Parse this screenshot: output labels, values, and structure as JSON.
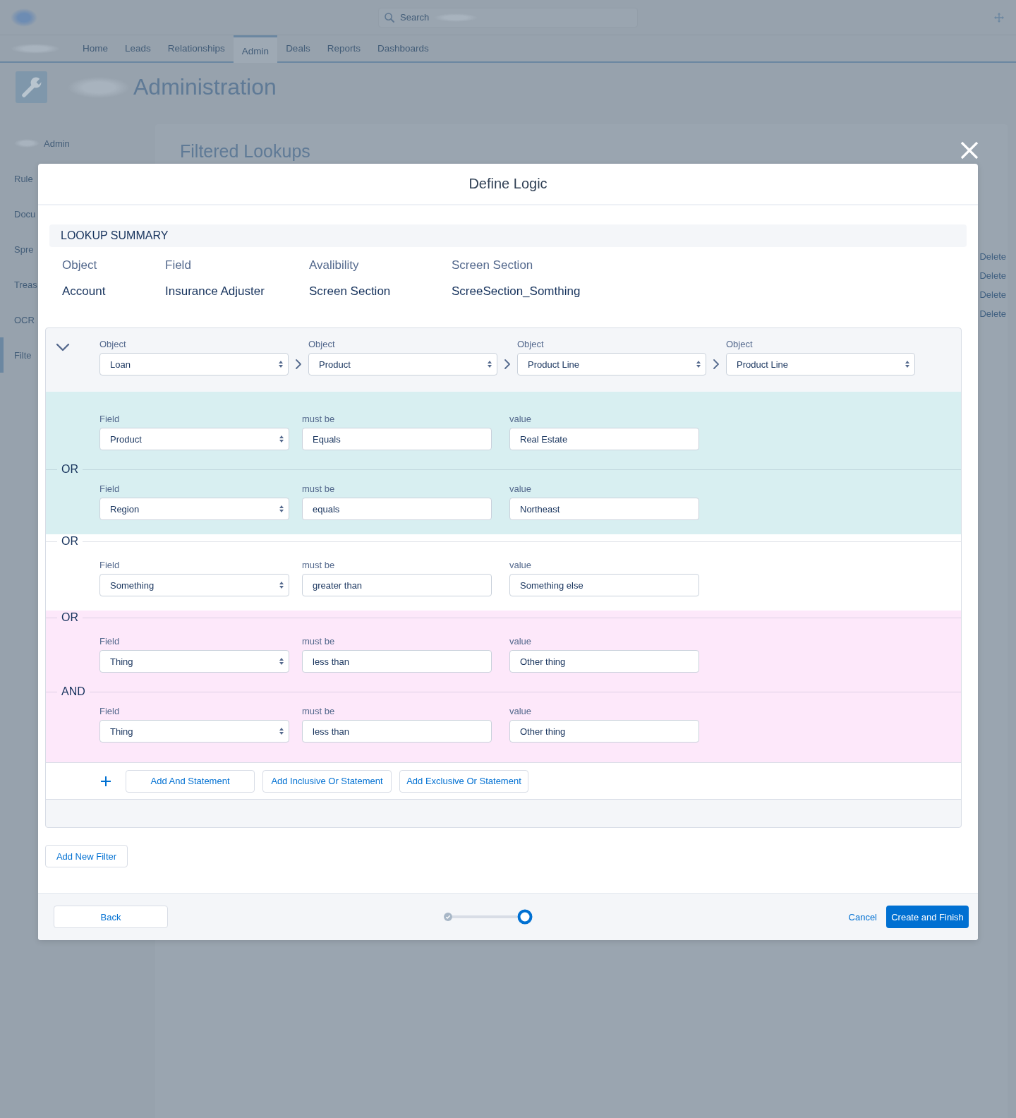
{
  "top_bar": {
    "search": {
      "placeholder": "Search"
    }
  },
  "nav": {
    "tabs": [
      {
        "label": "Home",
        "selected": false
      },
      {
        "label": "Leads",
        "selected": false
      },
      {
        "label": "Relationships",
        "selected": false
      },
      {
        "label": "Admin",
        "selected": true
      },
      {
        "label": "Deals",
        "selected": false
      },
      {
        "label": "Reports",
        "selected": false
      },
      {
        "label": "Dashboards",
        "selected": false
      }
    ]
  },
  "page_header": {
    "title": "Administration"
  },
  "sidebar": {
    "items": [
      {
        "label": "Admin",
        "selected": false,
        "blurred_prefix": true
      },
      {
        "label": "Rule",
        "selected": false,
        "blurred_prefix": false
      },
      {
        "label": "Docu",
        "selected": false,
        "blurred_prefix": false
      },
      {
        "label": "Spre",
        "selected": false,
        "blurred_prefix": false
      },
      {
        "label": "Treas",
        "selected": false,
        "blurred_prefix": false
      },
      {
        "label": "OCR",
        "selected": false,
        "blurred_prefix": false
      },
      {
        "label": "Filte",
        "selected": true,
        "blurred_prefix": false
      }
    ]
  },
  "content": {
    "title": "Filtered Lookups",
    "row_actions": [
      "Delete",
      "Delete",
      "Delete",
      "Delete"
    ]
  },
  "modal": {
    "title": "Define Logic",
    "summary": {
      "heading": "LOOKUP SUMMARY",
      "columns": [
        {
          "label": "Object",
          "value": "Account"
        },
        {
          "label": "Field",
          "value": "Insurance Adjuster"
        },
        {
          "label": "Avalibility",
          "value": "Screen Section"
        },
        {
          "label": "Screen Section",
          "value": "ScreeSection_Somthing"
        }
      ]
    },
    "filter": {
      "expanded": true,
      "objects": [
        {
          "label": "Object",
          "value": "Loan"
        },
        {
          "label": "Object",
          "value": "Product"
        },
        {
          "label": "Object",
          "value": "Product Line"
        },
        {
          "label": "Object",
          "value": "Product Line"
        }
      ],
      "groups": [
        {
          "color": "#d8eff1",
          "conditions": [
            {
              "field_label": "Field",
              "field": "Product",
              "operator_label": "must be",
              "operator": "Equals",
              "value_label": "value",
              "value": "Real Estate"
            },
            {
              "join": "OR",
              "field_label": "Field",
              "field": "Region",
              "operator_label": "must be",
              "operator": "equals",
              "value_label": "value",
              "value": "Northeast"
            }
          ]
        },
        {
          "join": "OR",
          "color": "#ffffff",
          "conditions": [
            {
              "field_label": "Field",
              "field": "Something",
              "operator_label": "must be",
              "operator": "greater than",
              "value_label": "value",
              "value": "Something else"
            }
          ]
        },
        {
          "join": "OR",
          "color": "#fde8fa",
          "conditions": [
            {
              "field_label": "Field",
              "field": "Thing",
              "operator_label": "must be",
              "operator": "less than",
              "value_label": "value",
              "value": "Other thing"
            },
            {
              "join": "AND",
              "field_label": "Field",
              "field": "Thing",
              "operator_label": "must be",
              "operator": "less than",
              "value_label": "value",
              "value": "Other thing"
            }
          ]
        }
      ],
      "add_buttons": [
        "Add And Statement",
        "Add Inclusive Or Statement",
        "Add Exclusive Or Statement"
      ]
    },
    "add_filter_button": "Add New Filter",
    "footer": {
      "back_button": "Back",
      "progress": {
        "steps": [
          {
            "completed": true,
            "selected": false
          },
          {
            "completed": false,
            "selected": true
          }
        ]
      },
      "cancel_link": "Cancel",
      "finish_button": "Create and Finish"
    }
  }
}
